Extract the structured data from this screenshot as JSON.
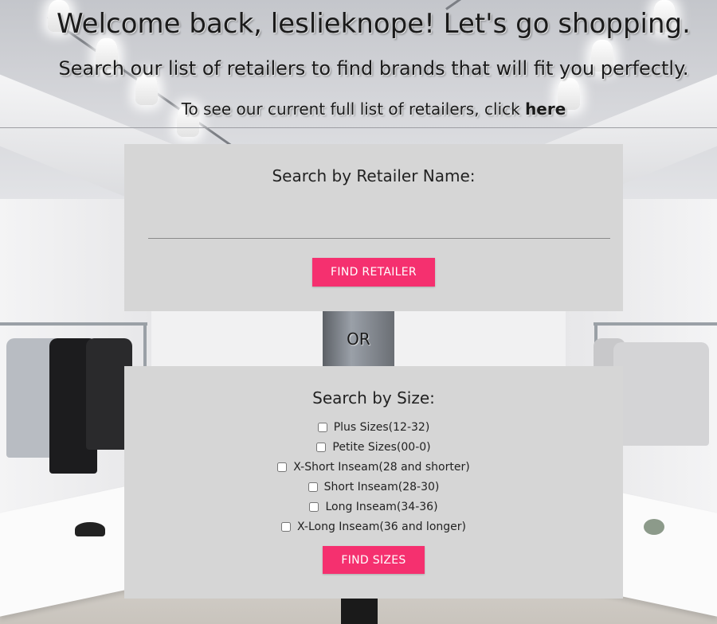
{
  "header": {
    "welcome": "Welcome back, leslieknope! Let's go shopping.",
    "subtitle": "Search our list of retailers to find brands that will fit you perfectly.",
    "full_list_prefix": "To see our current full list of retailers, click ",
    "full_list_link": "here"
  },
  "retailer_search": {
    "title": "Search by Retailer Name:",
    "input_value": "",
    "button_label": "FIND RETAILER"
  },
  "or_label": "OR",
  "size_search": {
    "title": "Search by Size:",
    "options": [
      {
        "label": "Plus Sizes(12-32)",
        "checked": false
      },
      {
        "label": "Petite Sizes(00-0)",
        "checked": false
      },
      {
        "label": "X-Short Inseam(28 and shorter)",
        "checked": false
      },
      {
        "label": "Short Inseam(28-30)",
        "checked": false
      },
      {
        "label": "Long Inseam(34-36)",
        "checked": false
      },
      {
        "label": "X-Long Inseam(36 and longer)",
        "checked": false
      }
    ],
    "button_label": "FIND SIZES"
  },
  "colors": {
    "accent": "#f5306f",
    "panel": "#d6d6d6"
  }
}
